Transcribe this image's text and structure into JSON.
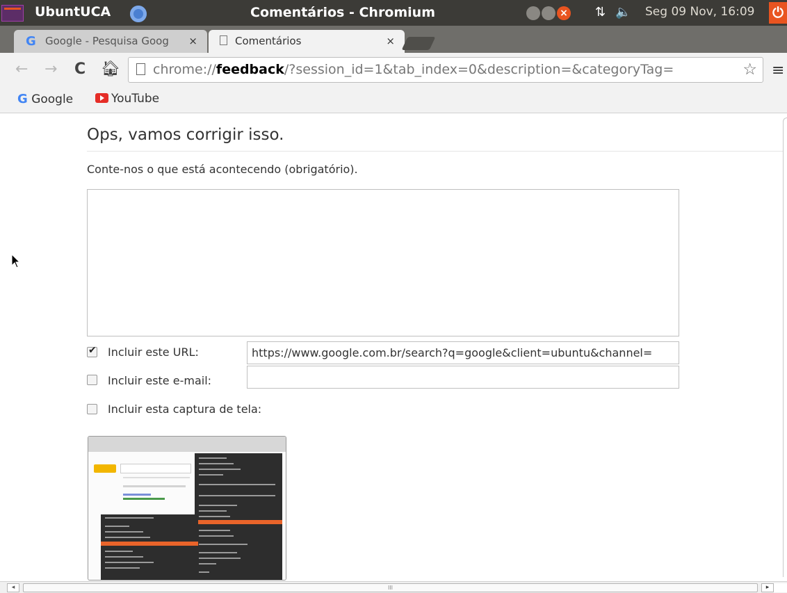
{
  "panel": {
    "app_name": "UbuntUCA",
    "window_title": "Comentários - Chromium",
    "clock": "Seg 09 Nov, 16:09"
  },
  "tabs": [
    {
      "label": "Google - Pesquisa Goog",
      "close": "×"
    },
    {
      "label": "Comentários",
      "close": "×"
    }
  ],
  "toolbar": {
    "url_scheme": "chrome://",
    "url_host": "feedback",
    "url_rest": "/?session_id=1&tab_index=0&description=&categoryTag="
  },
  "bookmarks": [
    {
      "label": "Google"
    },
    {
      "label": "YouTube"
    }
  ],
  "page": {
    "title": "Ops, vamos corrigir isso.",
    "description_label": "Conte-nos o que está acontecendo (obrigatório).",
    "description_value": "",
    "url_label": "Incluir este URL:",
    "url_checked": true,
    "url_value": "https://www.google.com.br/search?q=google&client=ubuntu&channel=",
    "email_label": "Incluir este e-mail:",
    "email_checked": false,
    "email_value": "",
    "screenshot_label": "Incluir esta captura de tela:",
    "screenshot_checked": false
  },
  "scrollbar": {
    "thumb_grip": "III"
  }
}
